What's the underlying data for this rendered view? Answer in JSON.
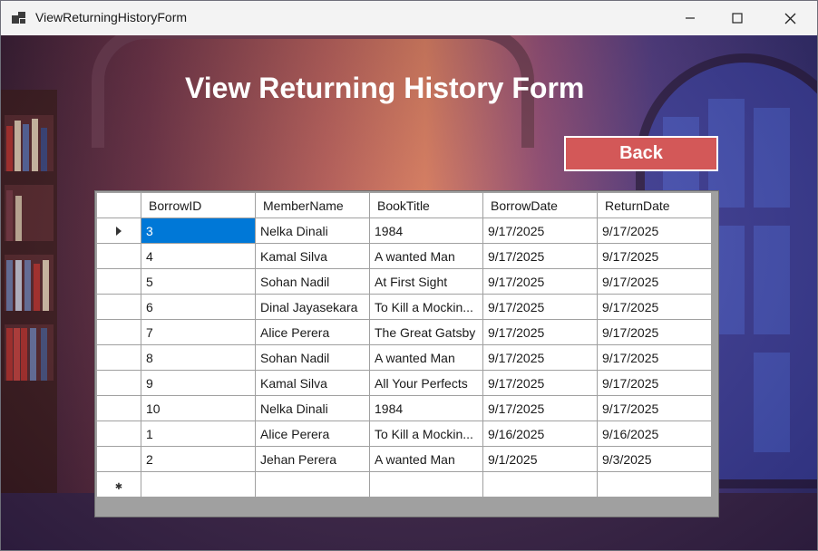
{
  "window": {
    "title": "ViewReturningHistoryForm"
  },
  "form": {
    "heading": "View Returning History Form",
    "back_label": "Back"
  },
  "grid": {
    "columns": [
      "BorrowID",
      "MemberName",
      "BookTitle",
      "BorrowDate",
      "ReturnDate"
    ],
    "rows": [
      [
        "3",
        "Nelka Dinali",
        "1984",
        "9/17/2025",
        "9/17/2025"
      ],
      [
        "4",
        "Kamal Silva",
        "A wanted Man",
        "9/17/2025",
        "9/17/2025"
      ],
      [
        "5",
        "Sohan Nadil",
        "At First Sight",
        "9/17/2025",
        "9/17/2025"
      ],
      [
        "6",
        "Dinal Jayasekara",
        "To Kill a Mockin...",
        "9/17/2025",
        "9/17/2025"
      ],
      [
        "7",
        "Alice Perera",
        "The Great Gatsby",
        "9/17/2025",
        "9/17/2025"
      ],
      [
        "8",
        "Sohan Nadil",
        "A wanted Man",
        "9/17/2025",
        "9/17/2025"
      ],
      [
        "9",
        "Kamal Silva",
        "All Your Perfects",
        "9/17/2025",
        "9/17/2025"
      ],
      [
        "10",
        "Nelka Dinali",
        "1984",
        "9/17/2025",
        "9/17/2025"
      ],
      [
        "1",
        "Alice Perera",
        "To Kill a Mockin...",
        "9/16/2025",
        "9/16/2025"
      ],
      [
        "2",
        "Jehan Perera",
        "A wanted Man",
        "9/1/2025",
        "9/3/2025"
      ]
    ],
    "selected_row": 0,
    "selected_color": "#0078d7"
  },
  "icons": {
    "app": "app-icon",
    "minimize": "minimize-icon",
    "maximize": "maximize-icon",
    "close": "close-icon",
    "current_row": "row-pointer-icon",
    "new_row": "new-row-icon"
  },
  "colors": {
    "back_button": "#d35858",
    "heading": "#ffffff"
  }
}
